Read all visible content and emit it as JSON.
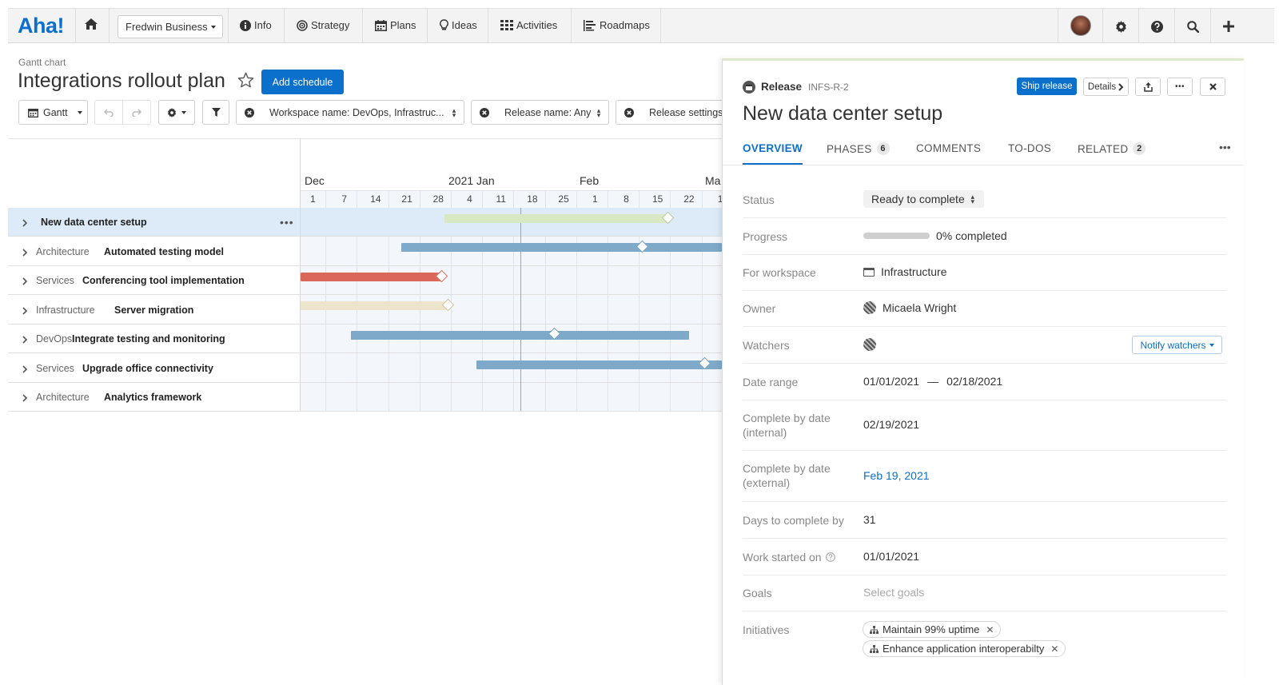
{
  "nav": {
    "logo": "Aha!",
    "workspace": "Fredwin Business",
    "items": [
      {
        "label": "Info",
        "icon": "info-icon"
      },
      {
        "label": "Strategy",
        "icon": "target-icon"
      },
      {
        "label": "Plans",
        "icon": "calendar-icon"
      },
      {
        "label": "Ideas",
        "icon": "lightbulb-icon"
      },
      {
        "label": "Activities",
        "icon": "grid-icon"
      },
      {
        "label": "Roadmaps",
        "icon": "roadmap-icon"
      }
    ],
    "right_icons": [
      "avatar",
      "gear-icon",
      "help-icon",
      "search-icon",
      "plus-icon"
    ]
  },
  "page": {
    "breadcrumb": "Gantt chart",
    "title": "Integrations rollout plan",
    "add_schedule": "Add schedule"
  },
  "toolbar": {
    "view": "Gantt",
    "filters": [
      "Workspace name: DevOps, Infrastruc...",
      "Release name: Any",
      "Release settings"
    ]
  },
  "timeline": {
    "months": [
      "Dec",
      "2021 Jan",
      "Feb",
      "Ma"
    ],
    "days": [
      "1",
      "7",
      "14",
      "21",
      "28",
      "4",
      "11",
      "18",
      "25",
      "1",
      "8",
      "15",
      "22",
      "1"
    ]
  },
  "rows": [
    {
      "category": "",
      "name": "New data center setup",
      "selected": true,
      "color": "#d9e8c4",
      "marker": "#b9c79b"
    },
    {
      "category": "Architecture",
      "name": "Automated testing model",
      "color": "#7ea9c9",
      "marker": "#6d9abd"
    },
    {
      "category": "Services",
      "name": "Conferencing tool implementation",
      "color": "#d9675a",
      "marker": "#d9675a"
    },
    {
      "category": "Infrastructure",
      "name": "Server migration",
      "color": "#ece5cc",
      "marker": "#c7bf9d"
    },
    {
      "category": "DevOps",
      "name": "Integrate testing and monitoring",
      "color": "#7ea9c9",
      "marker": "#6d9abd"
    },
    {
      "category": "Services",
      "name": "Upgrade office connectivity",
      "color": "#7ea9c9",
      "marker": "#6d9abd"
    },
    {
      "category": "Architecture",
      "name": "Analytics framework",
      "color": "",
      "marker": ""
    }
  ],
  "panel": {
    "type": "Release",
    "id": "INFS-R-2",
    "ship_label": "Ship release",
    "details_label": "Details",
    "title": "New data center setup",
    "tabs": [
      {
        "label": "OVERVIEW",
        "count": ""
      },
      {
        "label": "PHASES",
        "count": "6"
      },
      {
        "label": "COMMENTS",
        "count": ""
      },
      {
        "label": "TO-DOS",
        "count": ""
      },
      {
        "label": "RELATED",
        "count": "2"
      }
    ],
    "fields": {
      "status_label": "Status",
      "status_value": "Ready to complete",
      "progress_label": "Progress",
      "progress_value": "0% completed",
      "progress_fraction": 0,
      "workspace_label": "For workspace",
      "workspace_value": "Infrastructure",
      "owner_label": "Owner",
      "owner_value": "Micaela Wright",
      "watchers_label": "Watchers",
      "notify_label": "Notify watchers",
      "date_range_label": "Date range",
      "date_start": "01/01/2021",
      "date_sep": "—",
      "date_end": "02/18/2021",
      "cbd_internal_label": "Complete by date (internal)",
      "cbd_internal_value": "02/19/2021",
      "cbd_external_label": "Complete by date (external)",
      "cbd_external_value": "Feb 19, 2021",
      "days_label": "Days to complete by",
      "days_value": "31",
      "work_started_label": "Work started on",
      "work_started_value": "01/01/2021",
      "goals_label": "Goals",
      "goals_value": "Select goals",
      "initiatives_label": "Initiatives",
      "initiatives": [
        "Maintain 99% uptime",
        "Enhance application interoperabilty"
      ]
    }
  },
  "colors": {
    "brand": "#0b6fcc",
    "today_line": "#e58a7a"
  }
}
